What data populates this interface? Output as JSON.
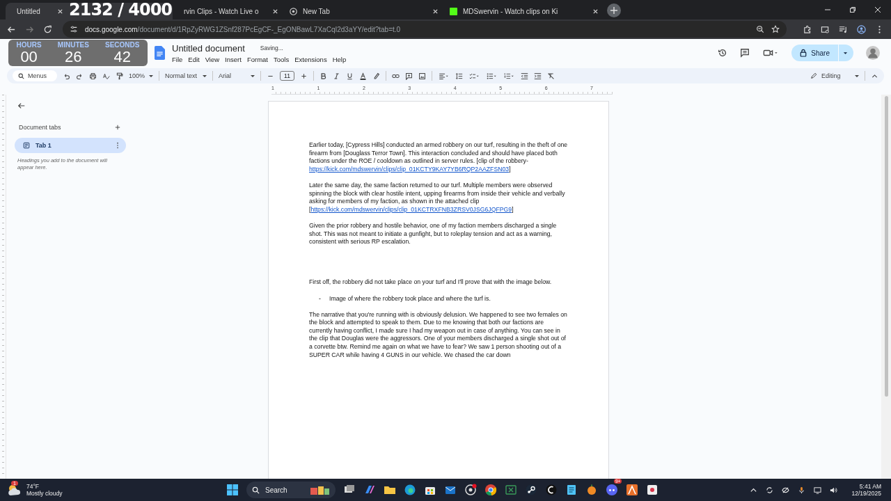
{
  "browser": {
    "tabs": [
      {
        "title": "Untitled",
        "selected": true
      },
      {
        "title": "rvin Clips - Watch Live o",
        "selected": false
      },
      {
        "title": "New Tab",
        "selected": false
      },
      {
        "title": "MDSwervin - Watch clips on Ki",
        "selected": false
      }
    ],
    "url_domain": "docs.google.com",
    "url_path": "/document/d/1RpZyRWG1ZSnf287PcEgCF-_EgONBawL7XaCqI2d3aYY/edit?tab=t.0"
  },
  "stream_overlay": {
    "counter": "2132 / 4000",
    "timer": [
      {
        "label": "HOURS",
        "value": "00"
      },
      {
        "label": "MINUTES",
        "value": "26"
      },
      {
        "label": "SECONDS",
        "value": "42"
      }
    ]
  },
  "docs": {
    "title": "Untitled document",
    "save_status": "Saving...",
    "menu": [
      "File",
      "Edit",
      "View",
      "Insert",
      "Format",
      "Tools",
      "Extensions",
      "Help"
    ],
    "share": "Share",
    "toolbar": {
      "search": "Menus",
      "zoom": "100%",
      "style": "Normal text",
      "font": "Arial",
      "size": "11",
      "mode": "Editing"
    },
    "ruler": [
      "1",
      "1",
      "2",
      "3",
      "4",
      "5",
      "6",
      "7"
    ]
  },
  "sidebar": {
    "heading": "Document tabs",
    "tabs": [
      {
        "label": "Tab 1",
        "selected": true
      }
    ],
    "hint": "Headings you add to the document will appear here."
  },
  "document": [
    {
      "kind": "para",
      "parts": [
        {
          "text": "Earlier today, [Cypress Hills] conducted an armed robbery on our turf, resulting in the theft of one firearm from [Douglass Terror Town]. This interaction concluded and should have placed both factions under the ROE / cooldown as outlined in server rules. [clip of the robbery-",
          "link": false
        },
        {
          "text": "https://kick.com/mdswervin/clips/clip_01KCTY9KAY7YB6RQP2AAZFSN03",
          "link": true
        },
        {
          "text": "]",
          "link": false
        }
      ]
    },
    {
      "kind": "para",
      "parts": [
        {
          "text": "Later the same day, the same faction returned to our turf. Multiple members were observed spinning the block with clear hostile intent, upping firearms from inside their vehicle and verbally asking for members of my faction, as shown in the attached clip [",
          "link": false
        },
        {
          "text": "https://kick.com/mdswervin/clips/clip_01KCTRXFNB3ZRSV0JSG6JQFPG9",
          "link": true
        },
        {
          "text": "]",
          "link": false
        }
      ]
    },
    {
      "kind": "para",
      "parts": [
        {
          "text": "Given the prior robbery and hostile behavior, one of my faction members discharged a single shot. This was not meant to initiate a gunfight, but to roleplay tension and act as a warning, consistent with serious RP escalation.",
          "link": false
        }
      ]
    },
    {
      "kind": "gap"
    },
    {
      "kind": "para",
      "parts": [
        {
          "text": "First off, the robbery did not take place on your turf and I'll prove that with the image below.",
          "link": false
        }
      ]
    },
    {
      "kind": "bullet",
      "marker": "-",
      "parts": [
        {
          "text": "Image of where the robbery took place and where the turf is.",
          "link": false
        }
      ]
    },
    {
      "kind": "para",
      "parts": [
        {
          "text": "The narrative that you're running with is obviously delusion. We happened to see two females on the block and attempted to speak to them. Due to me knowing that both our factions are currently having conflict, I made sure I had my weapon out in case of anything. You can see in the clip that Douglas were the aggressors. One of your members discharged a single shot out of a corvette btw. Remind me again on what we have to fear? We saw 1 person shooting out of a SUPER CAR while having 4 GUNS in our vehicle. We chased the car down",
          "link": false
        }
      ]
    }
  ],
  "taskbar": {
    "weather_badge": "1",
    "temperature": "74°F",
    "weather": "Mostly cloudy",
    "search": "Search",
    "discord_badge": "9+",
    "time": "5:41 AM",
    "date": "12/19/2025"
  }
}
